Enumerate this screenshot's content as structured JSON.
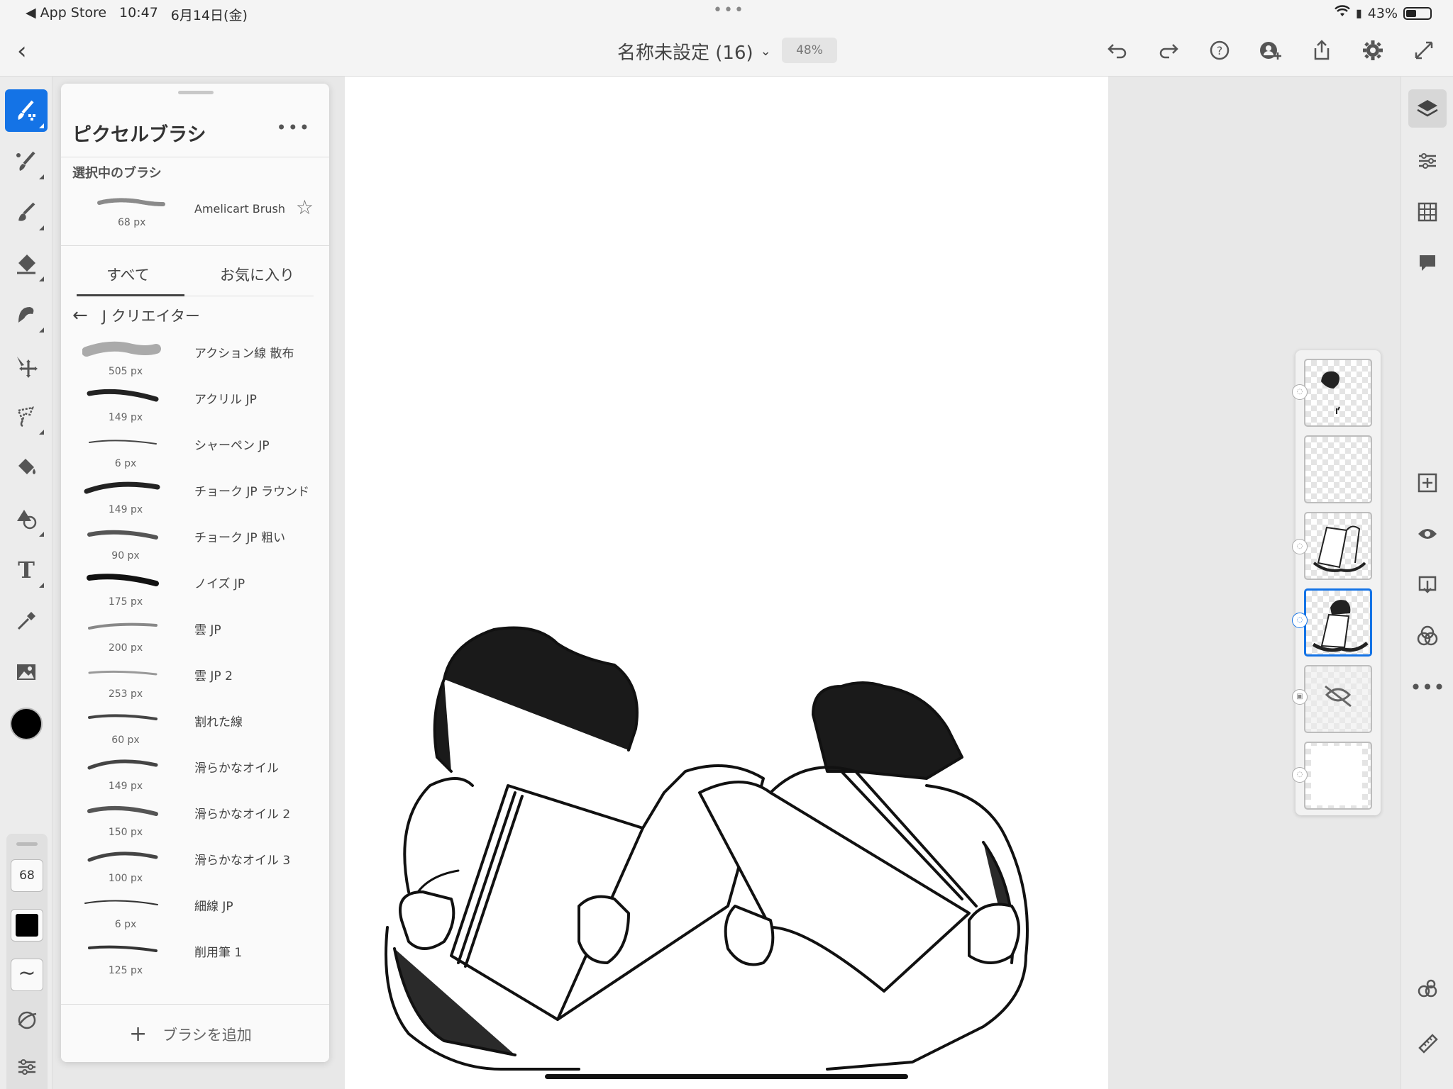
{
  "status": {
    "back_app": "◀ App Store",
    "time": "10:47",
    "date": "6月14日(金)",
    "dots": "•••",
    "battery": "43%"
  },
  "topbar": {
    "doc_title": "名称未設定 (16)",
    "zoom": "48%"
  },
  "toolbar": {
    "brush_size": "68",
    "color": "#000000",
    "accent": "#1473e6"
  },
  "brush_panel": {
    "title": "ピクセルブラシ",
    "selected_label": "選択中のブラシ",
    "selected_brush": {
      "name": "Amelicart Brush",
      "size": "68 px"
    },
    "tabs": [
      "すべて",
      "お気に入り"
    ],
    "active_tab": "すべて",
    "category": "J クリエイター",
    "brushes": [
      {
        "name": "アクション線 散布",
        "size": "505 px"
      },
      {
        "name": "アクリル JP",
        "size": "149 px"
      },
      {
        "name": "シャーペン JP",
        "size": "6 px"
      },
      {
        "name": "チョーク JP ラウンド",
        "size": "149 px"
      },
      {
        "name": "チョーク JP 粗い",
        "size": "90 px"
      },
      {
        "name": "ノイズ JP",
        "size": "175 px"
      },
      {
        "name": "雲 JP",
        "size": "200 px"
      },
      {
        "name": "雲 JP 2",
        "size": "253 px"
      },
      {
        "name": "割れた線",
        "size": "60 px"
      },
      {
        "name": "滑らかなオイル",
        "size": "149 px"
      },
      {
        "name": "滑らかなオイル 2",
        "size": "150 px"
      },
      {
        "name": "滑らかなオイル 3",
        "size": "100 px"
      },
      {
        "name": "細線 JP",
        "size": "6 px"
      },
      {
        "name": "削用筆 1",
        "size": "125 px"
      }
    ],
    "add_label": "ブラシを追加"
  }
}
